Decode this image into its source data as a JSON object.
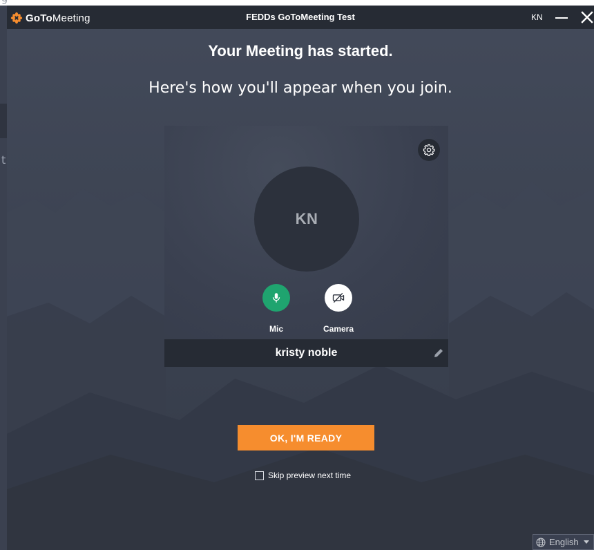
{
  "app": {
    "logo_bold": "GoTo",
    "logo_light": "Meeting",
    "window_title": "FEDDs GoToMeeting Test",
    "user_initials": "KN"
  },
  "main": {
    "headline": "Your Meeting has started.",
    "subhead": "Here's how you'll appear when you join."
  },
  "preview": {
    "avatar_initials": "KN",
    "mic_label": "Mic",
    "camera_label": "Camera",
    "display_name": "kristy noble"
  },
  "actions": {
    "ready_label": "OK, I'M READY",
    "skip_label": "Skip preview next time",
    "skip_checked": false
  },
  "language": {
    "selected": "English"
  },
  "colors": {
    "accent": "#f68d2e",
    "mic_active": "#1fa46f",
    "titlebar": "#262b34",
    "background": "#3c4352"
  },
  "icons": {
    "settings": "gear-icon",
    "mic": "microphone-icon",
    "camera": "camera-off-icon",
    "edit": "pencil-icon",
    "language": "globe-icon",
    "minimize": "minimize-icon",
    "close": "close-icon"
  }
}
